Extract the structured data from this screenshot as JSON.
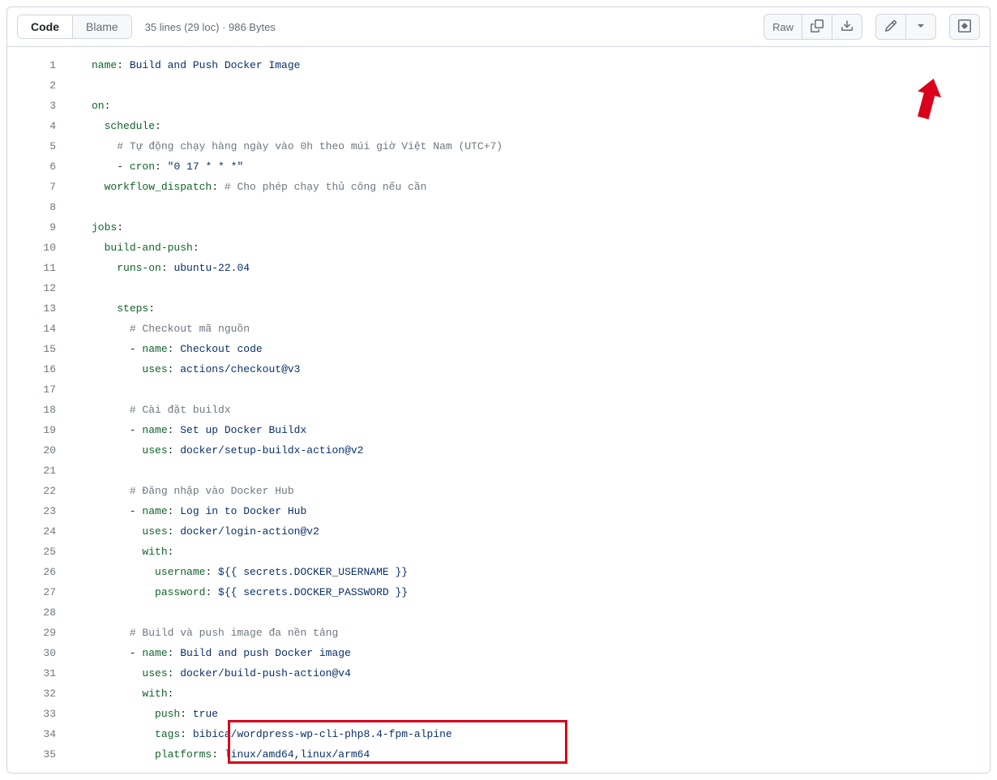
{
  "toolbar": {
    "tabs": {
      "code": "Code",
      "blame": "Blame"
    },
    "file_info": "35 lines (29 loc) · 986 Bytes",
    "raw": "Raw"
  },
  "code": {
    "lines": [
      [
        {
          "t": "name",
          "c": "key"
        },
        {
          "t": ": ",
          "c": "txt"
        },
        {
          "t": "Build and Push Docker Image",
          "c": "str"
        }
      ],
      [],
      [
        {
          "t": "on",
          "c": "key"
        },
        {
          "t": ":",
          "c": "txt"
        }
      ],
      [
        {
          "t": "  ",
          "c": "txt"
        },
        {
          "t": "schedule",
          "c": "key"
        },
        {
          "t": ":",
          "c": "txt"
        }
      ],
      [
        {
          "t": "    ",
          "c": "txt"
        },
        {
          "t": "# Tự động chạy hàng ngày vào 0h theo múi giờ Việt Nam (UTC+7)",
          "c": "com"
        }
      ],
      [
        {
          "t": "    - ",
          "c": "txt"
        },
        {
          "t": "cron",
          "c": "key"
        },
        {
          "t": ": ",
          "c": "txt"
        },
        {
          "t": "\"0 17 * * *\"",
          "c": "str"
        }
      ],
      [
        {
          "t": "  ",
          "c": "txt"
        },
        {
          "t": "workflow_dispatch",
          "c": "key"
        },
        {
          "t": ": ",
          "c": "txt"
        },
        {
          "t": "# Cho phép chạy thủ công nếu cần",
          "c": "com"
        }
      ],
      [],
      [
        {
          "t": "jobs",
          "c": "key"
        },
        {
          "t": ":",
          "c": "txt"
        }
      ],
      [
        {
          "t": "  ",
          "c": "txt"
        },
        {
          "t": "build-and-push",
          "c": "key"
        },
        {
          "t": ":",
          "c": "txt"
        }
      ],
      [
        {
          "t": "    ",
          "c": "txt"
        },
        {
          "t": "runs-on",
          "c": "key"
        },
        {
          "t": ": ",
          "c": "txt"
        },
        {
          "t": "ubuntu-22.04",
          "c": "str"
        }
      ],
      [],
      [
        {
          "t": "    ",
          "c": "txt"
        },
        {
          "t": "steps",
          "c": "key"
        },
        {
          "t": ":",
          "c": "txt"
        }
      ],
      [
        {
          "t": "      ",
          "c": "txt"
        },
        {
          "t": "# Checkout mã nguồn",
          "c": "com"
        }
      ],
      [
        {
          "t": "      - ",
          "c": "txt"
        },
        {
          "t": "name",
          "c": "key"
        },
        {
          "t": ": ",
          "c": "txt"
        },
        {
          "t": "Checkout code",
          "c": "str"
        }
      ],
      [
        {
          "t": "        ",
          "c": "txt"
        },
        {
          "t": "uses",
          "c": "key"
        },
        {
          "t": ": ",
          "c": "txt"
        },
        {
          "t": "actions/checkout@v3",
          "c": "str"
        }
      ],
      [],
      [
        {
          "t": "      ",
          "c": "txt"
        },
        {
          "t": "# Cài đặt buildx",
          "c": "com"
        }
      ],
      [
        {
          "t": "      - ",
          "c": "txt"
        },
        {
          "t": "name",
          "c": "key"
        },
        {
          "t": ": ",
          "c": "txt"
        },
        {
          "t": "Set up Docker Buildx",
          "c": "str"
        }
      ],
      [
        {
          "t": "        ",
          "c": "txt"
        },
        {
          "t": "uses",
          "c": "key"
        },
        {
          "t": ": ",
          "c": "txt"
        },
        {
          "t": "docker/setup-buildx-action@v2",
          "c": "str"
        }
      ],
      [],
      [
        {
          "t": "      ",
          "c": "txt"
        },
        {
          "t": "# Đăng nhập vào Docker Hub",
          "c": "com"
        }
      ],
      [
        {
          "t": "      - ",
          "c": "txt"
        },
        {
          "t": "name",
          "c": "key"
        },
        {
          "t": ": ",
          "c": "txt"
        },
        {
          "t": "Log in to Docker Hub",
          "c": "str"
        }
      ],
      [
        {
          "t": "        ",
          "c": "txt"
        },
        {
          "t": "uses",
          "c": "key"
        },
        {
          "t": ": ",
          "c": "txt"
        },
        {
          "t": "docker/login-action@v2",
          "c": "str"
        }
      ],
      [
        {
          "t": "        ",
          "c": "txt"
        },
        {
          "t": "with",
          "c": "key"
        },
        {
          "t": ":",
          "c": "txt"
        }
      ],
      [
        {
          "t": "          ",
          "c": "txt"
        },
        {
          "t": "username",
          "c": "key"
        },
        {
          "t": ": ",
          "c": "txt"
        },
        {
          "t": "${{ secrets.DOCKER_USERNAME }}",
          "c": "str"
        }
      ],
      [
        {
          "t": "          ",
          "c": "txt"
        },
        {
          "t": "password",
          "c": "key"
        },
        {
          "t": ": ",
          "c": "txt"
        },
        {
          "t": "${{ secrets.DOCKER_PASSWORD }}",
          "c": "str"
        }
      ],
      [],
      [
        {
          "t": "      ",
          "c": "txt"
        },
        {
          "t": "# Build và push image đa nền tảng",
          "c": "com"
        }
      ],
      [
        {
          "t": "      - ",
          "c": "txt"
        },
        {
          "t": "name",
          "c": "key"
        },
        {
          "t": ": ",
          "c": "txt"
        },
        {
          "t": "Build and push Docker image",
          "c": "str"
        }
      ],
      [
        {
          "t": "        ",
          "c": "txt"
        },
        {
          "t": "uses",
          "c": "key"
        },
        {
          "t": ": ",
          "c": "txt"
        },
        {
          "t": "docker/build-push-action@v4",
          "c": "str"
        }
      ],
      [
        {
          "t": "        ",
          "c": "txt"
        },
        {
          "t": "with",
          "c": "key"
        },
        {
          "t": ":",
          "c": "txt"
        }
      ],
      [
        {
          "t": "          ",
          "c": "txt"
        },
        {
          "t": "push",
          "c": "key"
        },
        {
          "t": ": ",
          "c": "txt"
        },
        {
          "t": "true",
          "c": "str"
        }
      ],
      [
        {
          "t": "          ",
          "c": "txt"
        },
        {
          "t": "tags",
          "c": "key"
        },
        {
          "t": ": ",
          "c": "txt"
        },
        {
          "t": "bibica/wordpress-wp-cli-php8.4-fpm-alpine",
          "c": "str"
        }
      ],
      [
        {
          "t": "          ",
          "c": "txt"
        },
        {
          "t": "platforms",
          "c": "key"
        },
        {
          "t": ": ",
          "c": "txt"
        },
        {
          "t": "linux/amd64,linux/arm64",
          "c": "str"
        }
      ]
    ]
  }
}
